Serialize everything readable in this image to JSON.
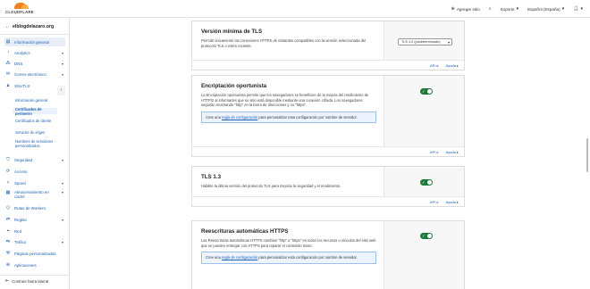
{
  "topbar": {
    "logo_text": "CLOUDFLARE",
    "add_site": "Agregar sitio",
    "support": "Soporte",
    "language": "Español (España)"
  },
  "sidebar": {
    "account": "elblogdelazaro.org",
    "items": [
      {
        "label": "Información general"
      },
      {
        "label": "Analytics"
      },
      {
        "label": "DNS"
      },
      {
        "label": "Correo electrónico"
      },
      {
        "label": "SSL/TLS"
      },
      {
        "label": "Seguridad"
      },
      {
        "label": "Acceso"
      },
      {
        "label": "Speed"
      },
      {
        "label": "Almacenamiento en caché"
      },
      {
        "label": "Rutas de Workers"
      },
      {
        "label": "Reglas"
      },
      {
        "label": "Red"
      },
      {
        "label": "Tráfico"
      },
      {
        "label": "Páginas personalizadas"
      },
      {
        "label": "Aplicaciones"
      }
    ],
    "ssl_sub": [
      {
        "label": "Información general"
      },
      {
        "label": "Certificados de perímetro"
      },
      {
        "label": "Certificados de cliente"
      },
      {
        "label": "Servidor de origen"
      },
      {
        "label": "Nombres de servidores personalizados"
      }
    ],
    "collapse": "Contraer barra lateral"
  },
  "cards": {
    "min_tls": {
      "title": "Versión mínima de TLS",
      "desc": "Permitir únicamente las conexiones HTTPS de visitantes compatibles con la versión seleccionada del protocolo TLS o estén reciente.",
      "select_value": "TLS 1.0 (predeterminado)",
      "api": "API",
      "help": "Ayuda"
    },
    "opportunistic": {
      "title": "Encriptación oportunista",
      "desc": "La Encriptación oportunista permite que los navegadores se beneficien de la mejora del rendimiento de HTTP/2 al informarles que su sitio está disponible mediante una conexión cifrada. Los navegadores seguirán mostrando \"http\" en la barra de direcciones y no \"https\".",
      "info_pre": "Cree una ",
      "info_link": "regla de configuración",
      "info_post": " para personalizar esta configuración por nombre de servidor.",
      "api": "API",
      "help": "Ayuda",
      "enabled": true
    },
    "tls13": {
      "title": "TLS 1.3",
      "desc": "Habilite la última versión del protocolo TLS para mejorar la seguridad y el rendimiento.",
      "api": "API",
      "help": "Ayuda",
      "enabled": true
    },
    "https_rewrites": {
      "title": "Reescrituras automáticas HTTPS",
      "desc": "Las Reescrituras automáticas HTTPS cambian \"http\" a \"https\" en todos los recursos o vínculos del sitio web que se pueden entregar con HTTPS para reparar el contenido mixto.",
      "info_pre": "Cree una ",
      "info_link": "regla de configuración",
      "info_post": " para personalizar esta configuración por nombre de servidor.",
      "enabled": true
    }
  },
  "colors": {
    "toggle_on": "#1a7a3a",
    "link": "#1a5fb4",
    "brand_orange": "#f38020"
  }
}
